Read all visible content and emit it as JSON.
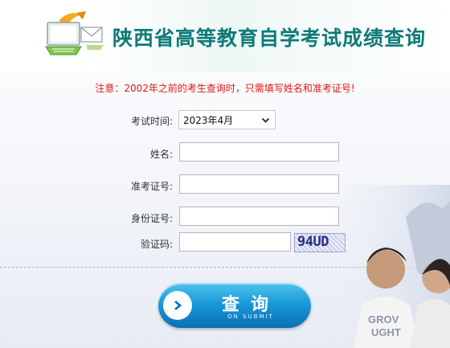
{
  "header": {
    "title": "陕西省高等教育自学考试成绩查询",
    "logo_icon": "computer-envelope-icon"
  },
  "notice": "注意：2002年之前的考生查询时，只需填写姓名和准考证号!",
  "form": {
    "exam_time": {
      "label": "考试时间:",
      "selected": "2023年4月"
    },
    "name": {
      "label": "姓名:",
      "value": ""
    },
    "ticket_number": {
      "label": "准考证号:",
      "value": ""
    },
    "id_number": {
      "label": "身份证号:",
      "value": ""
    },
    "captcha": {
      "label": "验证码:",
      "value": "",
      "image_text": "94UD"
    }
  },
  "submit": {
    "label": "查询",
    "sub_label": "ON SUBMIT",
    "icon": "chevron-right-icon"
  },
  "colors": {
    "title": "#0e7b78",
    "notice": "#e01818",
    "button": "#1a9bd8"
  }
}
